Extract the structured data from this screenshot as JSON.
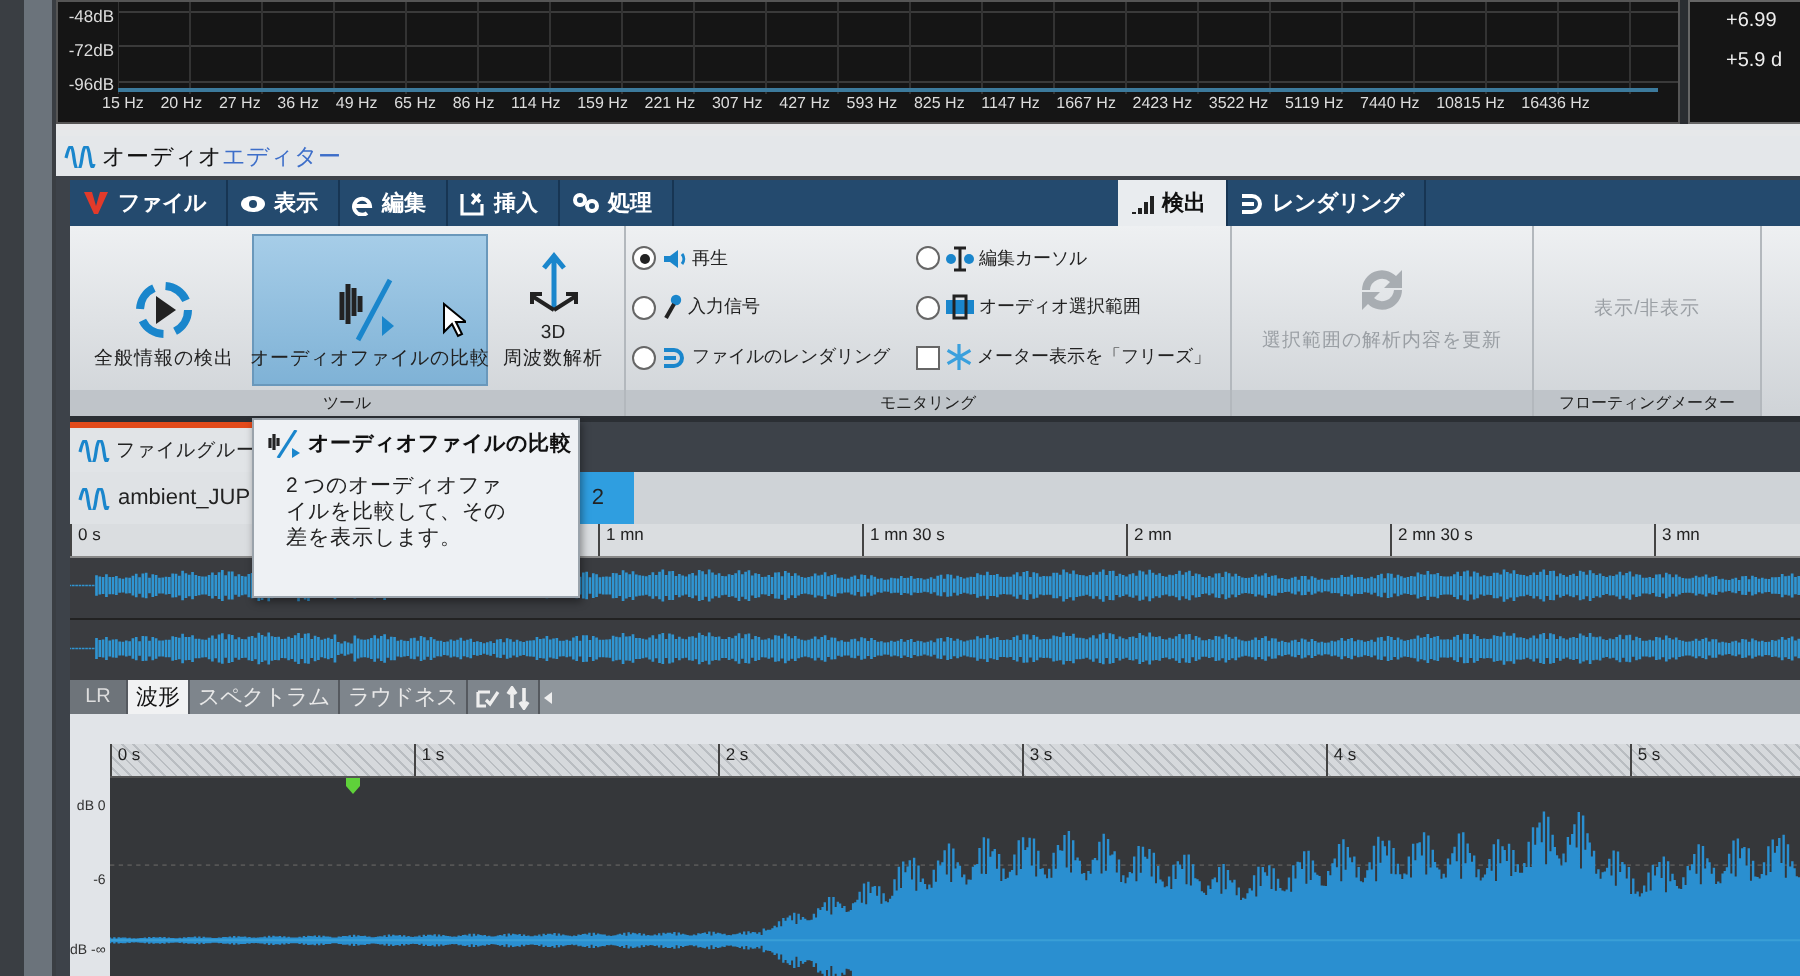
{
  "spectrum": {
    "db_labels": [
      "-48dB",
      "-72dB",
      "-96dB"
    ],
    "freq_labels": [
      "15 Hz",
      "20 Hz",
      "27 Hz",
      "36 Hz",
      "49 Hz",
      "65 Hz",
      "86 Hz",
      "114 Hz",
      "159 Hz",
      "221 Hz",
      "307 Hz",
      "427 Hz",
      "593 Hz",
      "825 Hz",
      "1147 Hz",
      "1667 Hz",
      "2423 Hz",
      "3522 Hz",
      "5119 Hz",
      "7440 Hz",
      "10815 Hz",
      "16436 Hz"
    ]
  },
  "meter": {
    "readings": [
      "+6.99",
      "+5.9 d"
    ]
  },
  "window": {
    "title_parts": [
      {
        "text": "オーディオ",
        "accent": false
      },
      {
        "text": "エディター",
        "accent": true
      }
    ]
  },
  "menu_tabs": [
    {
      "label": "ファイル",
      "selected": false
    },
    {
      "label": "表示",
      "selected": false
    },
    {
      "label": "編集",
      "selected": false
    },
    {
      "label": "挿入",
      "selected": false
    },
    {
      "label": "処理",
      "selected": false
    }
  ],
  "mode_tabs": [
    {
      "label": "検出",
      "selected": true
    },
    {
      "label": "レンダリング",
      "selected": false
    }
  ],
  "ribbon": {
    "tools": {
      "label": "ツール",
      "buttons": [
        {
          "label": "全般情報の検出",
          "selected": false
        },
        {
          "label": "オーディオファイルの比較",
          "selected": true
        },
        {
          "label": "3D\n周波数解析",
          "selected": false
        }
      ]
    },
    "monitoring": {
      "label": "モニタリング",
      "options": [
        {
          "kind": "radio",
          "label": "再生",
          "checked": true
        },
        {
          "kind": "radio",
          "label": "入力信号",
          "checked": false
        },
        {
          "kind": "radio",
          "label": "ファイルのレンダリング",
          "checked": false
        },
        {
          "kind": "radio",
          "label": "編集カーソル",
          "checked": false
        },
        {
          "kind": "radio",
          "label": "オーディオ選択範囲",
          "checked": false
        },
        {
          "kind": "checkbox",
          "label": "メーター表示を「フリーズ」",
          "checked": false
        }
      ]
    },
    "update": {
      "label": "選択範囲の解析内容を更新",
      "disabled": true
    },
    "floating": {
      "label": "フローティングメーター",
      "button": {
        "label": "表示/非表示",
        "disabled": true
      }
    }
  },
  "file_group_tab": {
    "label": "ファイルグルー"
  },
  "file_tabs": [
    {
      "label": "ambient_JUP",
      "selected": false
    },
    {
      "label": "2",
      "selected": true
    }
  ],
  "overview": {
    "ruler_labels": [
      "0 s",
      "1 mn",
      "1 mn 30 s",
      "2 mn",
      "2 mn 30 s",
      "3 mn"
    ]
  },
  "view_tabs": {
    "channel_label": "LR",
    "tabs": [
      {
        "label": "波形",
        "selected": true
      },
      {
        "label": "スペクトラム",
        "selected": false
      },
      {
        "label": "ラウドネス",
        "selected": false
      }
    ]
  },
  "detail": {
    "ruler_labels": [
      "0 s",
      "1 s",
      "2 s",
      "3 s",
      "4 s",
      "5 s"
    ],
    "level_labels": [
      "dB 0",
      "-6",
      "dB -∞"
    ]
  },
  "tooltip": {
    "title": "オーディオファイルの比較",
    "text": "2 つのオーディオファイルを比較して、その差を表示します。"
  }
}
